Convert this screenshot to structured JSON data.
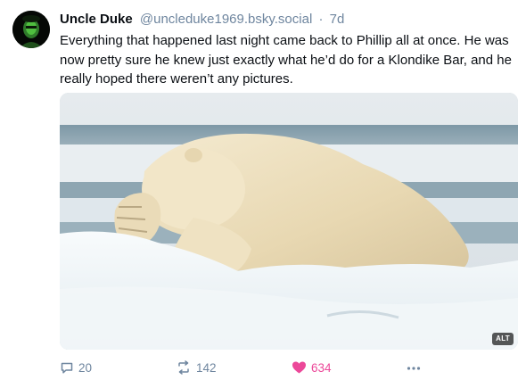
{
  "post": {
    "author": {
      "display_name": "Uncle Duke",
      "handle": "@uncleduke1969.bsky.social",
      "separator": "·",
      "timestamp": "7d",
      "avatar_icon": "avatar-green-portrait"
    },
    "text": "Everything that happened last night came back to Phillip all at once. He was now pretty sure he knew just exactly what he’d do for a Klondike Bar, and he really hoped there weren’t any pictures.",
    "image": {
      "subject": "polar-bear-covering-face-on-ice",
      "alt_badge": "ALT"
    },
    "actions": {
      "reply": {
        "icon": "comment-icon",
        "count": "20"
      },
      "repost": {
        "icon": "repost-icon",
        "count": "142"
      },
      "like": {
        "icon": "heart-filled-icon",
        "count": "634",
        "color": "#ec4899"
      },
      "more": {
        "icon": "more-dots-icon"
      }
    }
  },
  "colors": {
    "text": "#0b0f14",
    "muted": "#6f869f",
    "like": "#ec4899"
  }
}
